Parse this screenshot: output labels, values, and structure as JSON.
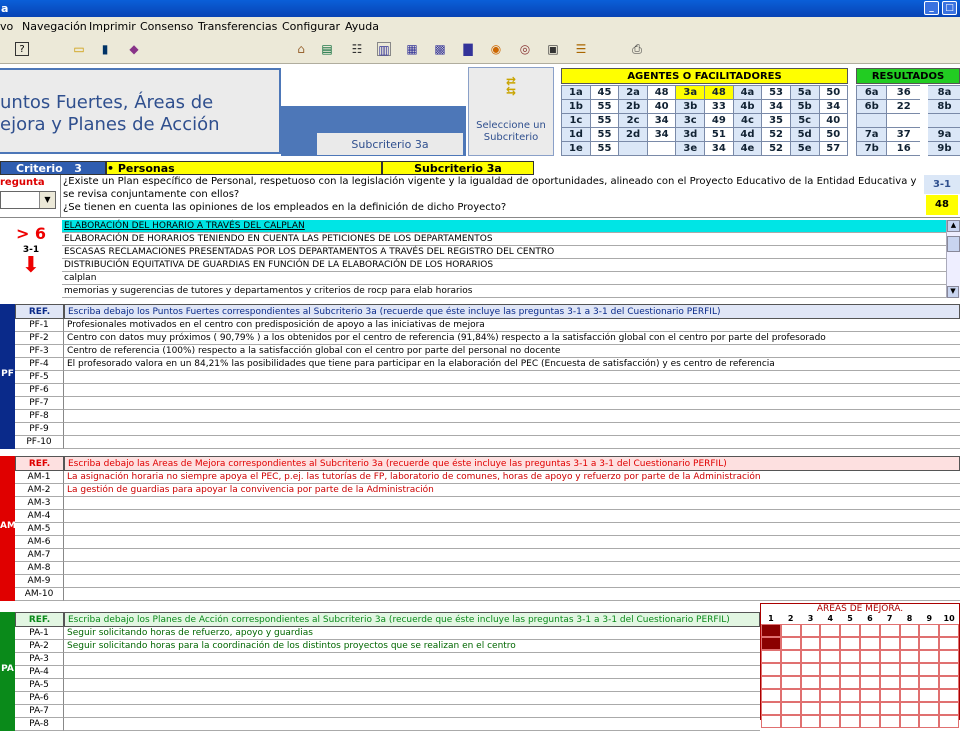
{
  "window": {
    "title": "a"
  },
  "menu": [
    "vo",
    "Navegación",
    "Imprimir",
    "Consenso",
    "Transferencias",
    "Configurar",
    "Ayuda"
  ],
  "header": {
    "title_line1": "untos Fuertes, Áreas de",
    "title_line2": "ejora y Planes de Acción",
    "subcriterio": "Subcriterio 3a",
    "select_label": "Seleccione un Subcriterio"
  },
  "agentes": {
    "title": "AGENTES O FACILITADORES",
    "rows": [
      [
        "1a",
        "45",
        "2a",
        "48",
        "3a",
        "48",
        "4a",
        "53",
        "5a",
        "50"
      ],
      [
        "1b",
        "55",
        "2b",
        "40",
        "3b",
        "33",
        "4b",
        "34",
        "5b",
        "34"
      ],
      [
        "1c",
        "55",
        "2c",
        "34",
        "3c",
        "49",
        "4c",
        "35",
        "5c",
        "40"
      ],
      [
        "1d",
        "55",
        "2d",
        "34",
        "3d",
        "51",
        "4d",
        "52",
        "5d",
        "50"
      ],
      [
        "1e",
        "55",
        "",
        "",
        "3e",
        "34",
        "4e",
        "52",
        "5e",
        "57"
      ]
    ]
  },
  "resultados": {
    "title": "RESULTADOS",
    "rows": [
      [
        "6a",
        "36",
        "8a",
        ""
      ],
      [
        "6b",
        "22",
        "8b",
        ""
      ],
      [
        "",
        "",
        "",
        ""
      ],
      [
        "7a",
        "37",
        "9a",
        ""
      ],
      [
        "7b",
        "16",
        "9b",
        ""
      ]
    ]
  },
  "criterio": {
    "label": "Criterio",
    "num": "3",
    "name": "• Personas",
    "sub": "Subcriterio 3a"
  },
  "pregunta": {
    "label": "regunta",
    "text1": "¿Existe un Plan específico de Personal, respetuoso con la legislación vigente y la igualdad de oportunidades, alineado con el Proyecto Educativo de la Entidad Educativa y",
    "text2": "se revisa conjuntamente con ellos?",
    "text3": "¿Se tienen en cuenta las opiniones de los empleados en la definición de dicho Proyecto?",
    "code": "3-1",
    "score": "48"
  },
  "evidence": {
    "score_label": "> 6",
    "code": "3-1",
    "items": [
      "ELABORACIÓN DEL HORARIO A TRAVÉS DEL CALPLAN",
      "ELABORACIÓN DE HORARIOS TENIENDO EN CUENTA LAS PETICIONES DE LOS DEPARTAMENTOS",
      "ESCASAS RECLAMACIONES PRESENTADAS POR LOS DEPARTAMENTOS A TRAVÉS DEL REGISTRO DEL CENTRO",
      "DISTRIBUCIÓN EQUITATIVA DE GUARDIAS EN FUNCIÓN DE LA ELABORACIÓN DE LOS HORARIOS",
      "calplan",
      "memorias y sugerencias de tutores y departamentos y criterios de rocp para elab horarios"
    ]
  },
  "pf": {
    "ref": "REF.",
    "header": "Escriba debajo los Puntos Fuertes correspondientes al Subcriterio 3a (recuerde que éste incluye las preguntas 3-1 a 3-1 del Cuestionario PERFIL)",
    "side": "PF",
    "color": "#0a2a8a",
    "refs": [
      "PF-1",
      "PF-2",
      "PF-3",
      "PF-4",
      "PF-5",
      "PF-6",
      "PF-7",
      "PF-8",
      "PF-9",
      "PF-10"
    ],
    "texts": [
      "Profesionales motivados en el centro con predisposición de apoyo a las iniciativas de mejora",
      "Centro con datos muy próximos ( 90,79% ) a los obtenidos por el centro de referencia (91,84%) respecto a la satisfacción global con el centro por parte del profesorado",
      "Centro de referencia (100%) respecto a la satisfacción global con el centro por parte del personal no docente",
      "El profesorado valora en  un 84,21% las posibilidades que tiene para participar en la elaboración del PEC (Encuesta de satisfacción) y es centro de referencia",
      "",
      "",
      "",
      "",
      "",
      ""
    ]
  },
  "am": {
    "ref": "REF.",
    "header": "Escriba debajo las Areas de Mejora correspondientes al Subcriterio 3a (recuerde que éste incluye las preguntas 3-1 a 3-1 del Cuestionario PERFIL)",
    "side": "AM",
    "color": "#e00000",
    "refs": [
      "AM-1",
      "AM-2",
      "AM-3",
      "AM-4",
      "AM-5",
      "AM-6",
      "AM-7",
      "AM-8",
      "AM-9",
      "AM-10"
    ],
    "texts": [
      "La asignación horaria no siempre apoya el PEC, p.ej. las tutorías de FP, laboratorio de comunes, horas de apoyo y refuerzo por parte de la Administración",
      "La gestión de guardias para apoyar la convivencia por parte de la Administración",
      "",
      "",
      "",
      "",
      "",
      "",
      "",
      ""
    ]
  },
  "pa": {
    "ref": "REF.",
    "header": "Escriba debajo los Planes de Acción correspondientes al Subcriterio 3a (recuerde que éste incluye las preguntas 3-1 a 3-1 del Cuestionario PERFIL)",
    "side": "PA",
    "color": "#0a8a1a",
    "refs": [
      "PA-1",
      "PA-2",
      "PA-3",
      "PA-4",
      "PA-5",
      "PA-6",
      "PA-7",
      "PA-8"
    ],
    "texts": [
      "Seguir solicitando horas de refuerzo, apoyo y guardias",
      "Seguir solicitando horas para la coordinación de los distintos proyectos que se realizan en el centro",
      "",
      "",
      "",
      "",
      "",
      ""
    ]
  },
  "areas": {
    "title": "AREAS DE MEJORA.",
    "cols": [
      "1",
      "2",
      "3",
      "4",
      "5",
      "6",
      "7",
      "8",
      "9",
      "10"
    ],
    "marked": [
      [
        0,
        0
      ],
      [
        1,
        0
      ]
    ],
    "color": "#8b0000"
  }
}
